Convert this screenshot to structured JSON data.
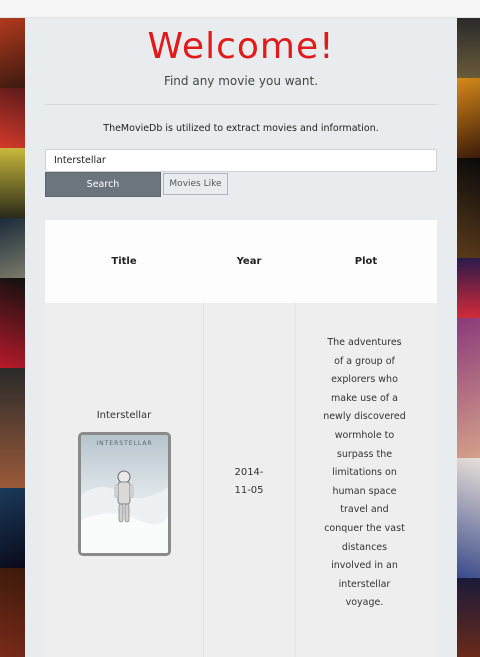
{
  "header": {
    "welcome": "Welcome!",
    "subtitle": "Find any movie you want.",
    "info": "TheMovieDb is utilized to extract movies and information."
  },
  "search": {
    "value": "Interstellar",
    "search_button": "Search",
    "movies_like_button": "Movies Like"
  },
  "table": {
    "headers": {
      "title": "Title",
      "year": "Year",
      "plot": "Plot"
    },
    "rows": [
      {
        "title": "Interstellar",
        "poster_text": "INTERSTELLAR",
        "year": "2014-\n11-05",
        "plot": "The adventures of a group of explorers who make use of a newly discovered wormhole to surpass the limitations on human space travel and conquer the vast distances involved in an interstellar voyage."
      }
    ]
  },
  "colors": {
    "welcome": "#e11a1a",
    "search_button": "#6c757d",
    "container": "#e9ecef"
  }
}
